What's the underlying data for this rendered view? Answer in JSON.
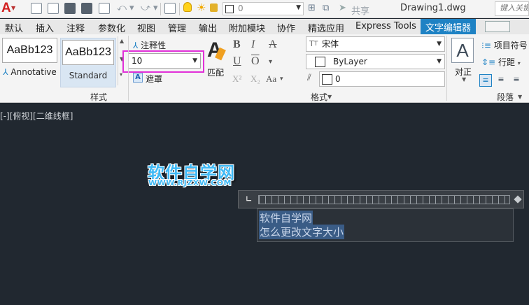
{
  "app": {
    "logo": "A"
  },
  "qat": {
    "layer_value": "0",
    "share_label": "共享",
    "document_title": "Drawing1.dwg",
    "search_placeholder": "键入关键字"
  },
  "ribbon_tabs": [
    "默认",
    "插入",
    "注释",
    "参数化",
    "视图",
    "管理",
    "输出",
    "附加模块",
    "协作",
    "精选应用",
    "Express Tools",
    "文字编辑器"
  ],
  "active_tab": "文字编辑器",
  "style_panel": {
    "title": "样式",
    "styles": [
      {
        "preview": "AaBb123",
        "name": "Annotative"
      },
      {
        "preview": "AaBb123",
        "name": "Standard"
      }
    ],
    "annotative_label": "注释性",
    "text_height_value": "10",
    "mask_label": "遮罩"
  },
  "format_panel": {
    "title": "格式",
    "match_label": "匹配",
    "bold": "B",
    "italic": "I",
    "strike": "A",
    "underline": "U",
    "overline": "O",
    "superscript": "X²",
    "subscript": "X₂",
    "case": "Aa",
    "font_value": "宋体",
    "color_value": "ByLayer",
    "oblique_value": "0"
  },
  "paragraph_panel": {
    "title": "段落",
    "justify_label": "对正",
    "bullets_label": "项目符号",
    "line_spacing_label": "行距"
  },
  "canvas": {
    "viewport_label": "[-][俯视][二维线框]",
    "watermark_title": "软件自学网",
    "watermark_url": "WWW.RJZXW.COM",
    "mtext_lines": [
      "软件自学网",
      "怎么更改文字大小"
    ]
  },
  "colors": {
    "accent": "#1e82c4",
    "highlight_box": "#e130d8",
    "canvas_bg": "#212830",
    "selection": "#3a5c86"
  }
}
